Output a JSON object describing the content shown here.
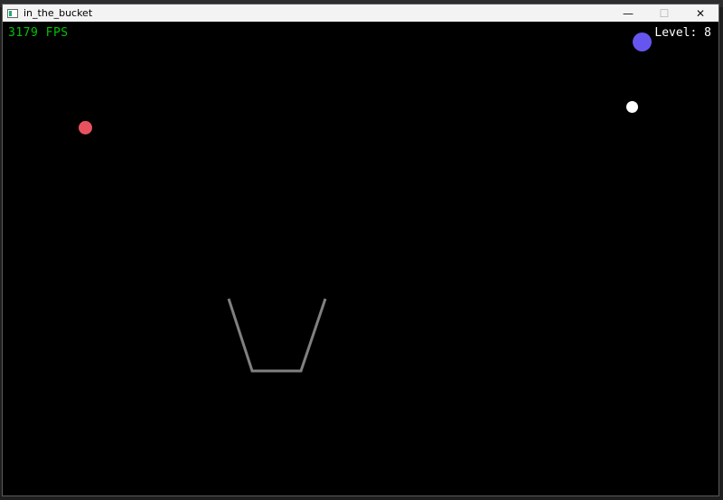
{
  "window": {
    "title": "in_the_bucket",
    "controls": {
      "minimize": "—",
      "maximize": "☐",
      "close": "✕"
    }
  },
  "hud": {
    "fps": "3179 FPS",
    "level": "Level: 8",
    "fps_color": "#00c400",
    "level_color": "#ffffff"
  },
  "balls": [
    {
      "name": "red-ball",
      "color": "#e8525f"
    },
    {
      "name": "blue-ball",
      "color": "#6655ee"
    },
    {
      "name": "white-ball",
      "color": "#ffffff"
    }
  ],
  "bucket": {
    "color": "#808080"
  },
  "colors": {
    "background": "#000000"
  }
}
